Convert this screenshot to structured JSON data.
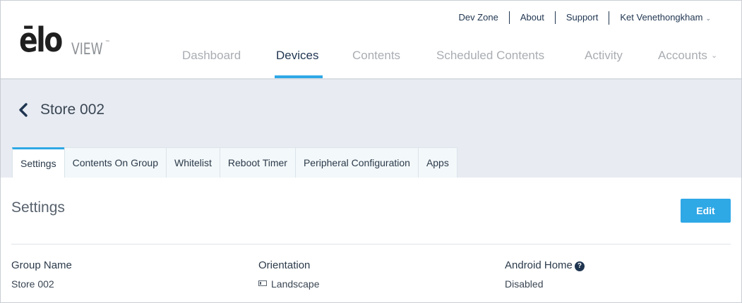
{
  "brand": {
    "logo_elo": "ēlo",
    "logo_view": "VIEW",
    "logo_tm": "™"
  },
  "utility_nav": {
    "items": [
      "Dev Zone",
      "About",
      "Support",
      "Ket Venethongkham"
    ]
  },
  "main_nav": {
    "items": [
      "Dashboard",
      "Devices",
      "Contents",
      "Scheduled Contents",
      "Activity",
      "Accounts"
    ],
    "active": "Devices"
  },
  "page": {
    "title": "Store 002"
  },
  "tabs": {
    "items": [
      "Settings",
      "Contents On Group",
      "Whitelist",
      "Reboot Timer",
      "Peripheral Configuration",
      "Apps"
    ],
    "active": "Settings"
  },
  "settings": {
    "section_title": "Settings",
    "edit_label": "Edit",
    "fields": [
      {
        "label": "Group Name",
        "value": "Store 002"
      },
      {
        "label": "Orientation",
        "value": "Landscape"
      },
      {
        "label": "Android Home",
        "value": "Disabled"
      }
    ]
  },
  "colors": {
    "accent": "#2fa8e6",
    "nav_active": "#1f3550",
    "band_bg": "#e8ebf2"
  },
  "icons": {
    "back": "chevron-left-icon",
    "dropdown": "chevron-down-icon",
    "help": "question-circle-icon",
    "orientation": "landscape-icon"
  }
}
